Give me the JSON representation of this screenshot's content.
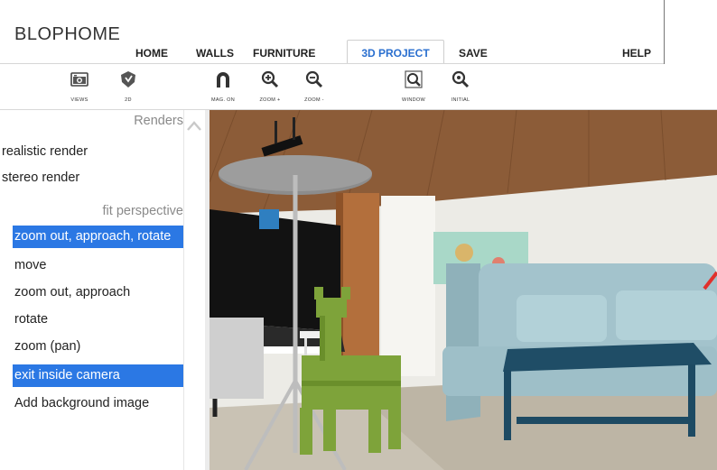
{
  "app": {
    "title": "BLOPHOME"
  },
  "nav": {
    "home": "HOME",
    "walls": "WALLS",
    "furniture": "FURNITURE",
    "project3d": "3D PROJECT",
    "save": "SAVE",
    "help": "HELP"
  },
  "toolbar": {
    "views": "VIEWS",
    "two_d": "2D",
    "mag_on": "MAG. ON",
    "zoom_in": "ZOOM +",
    "zoom_out": "ZOOM -",
    "window": "WINDOW",
    "initial": "INITIAL"
  },
  "side": {
    "renders_title": "Renders",
    "realistic": "realistic render",
    "stereo": "stereo render",
    "fit_title": "fit perspective",
    "zoom_approach_rotate": "zoom out, approach, rotate",
    "move": "move",
    "zoom_approach": "zoom out, approach",
    "rotate": "rotate",
    "zoom_pan": "zoom (pan)",
    "exit_camera": "exit inside camera",
    "add_bg": "Add background image"
  },
  "colors": {
    "accent": "#2b78e4",
    "active_tab": "#2a6fcf",
    "wood_ceiling": "#8a5a36",
    "sofa": "#9fc0c9",
    "table": "#1d4a63",
    "deer": "#7ea33a"
  }
}
